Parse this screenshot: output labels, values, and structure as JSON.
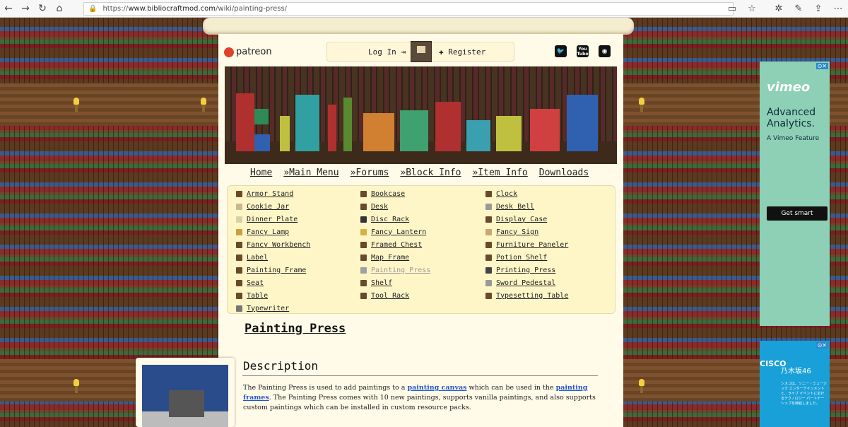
{
  "browser": {
    "url_prefix": "https://",
    "url_host": "www.bibliocraftmod.com",
    "url_path": "/wiki/painting-press/"
  },
  "header": {
    "patreon_label": "patreon",
    "login_label": "Log In",
    "register_label": "Register",
    "social": [
      {
        "name": "twitter-icon",
        "glyph": "t"
      },
      {
        "name": "youtube-icon",
        "glyph": "You Tube"
      },
      {
        "name": "github-icon",
        "glyph": "gh"
      }
    ]
  },
  "menu": {
    "items": [
      "Home",
      "»Main Menu",
      "»Forums",
      "»Block Info",
      "»Item Info",
      "Downloads"
    ]
  },
  "blocks": {
    "col1": [
      "Armor Stand",
      "Cookie Jar",
      "Dinner Plate",
      "Fancy Lamp",
      "Fancy Workbench",
      "Label",
      "Painting Frame",
      "Seat",
      "Table",
      "Typewriter"
    ],
    "col2": [
      "Bookcase",
      "Desk",
      "Disc Rack",
      "Fancy Lantern",
      "Framed Chest",
      "Map Frame",
      "Painting Press",
      "Shelf",
      "Tool Rack"
    ],
    "col3": [
      "Clock",
      "Desk Bell",
      "Display Case",
      "Fancy Sign",
      "Furniture Paneler",
      "Potion Shelf",
      "Printing Press",
      "Sword Pedestal",
      "Typesetting Table"
    ],
    "active": "Painting Press"
  },
  "content": {
    "title": "Painting Press",
    "description_heading": "Description",
    "desc_part1": "The Painting Press is used to add paintings to a ",
    "desc_link1": "painting canvas",
    "desc_part2": " which can be used in the ",
    "desc_link2": "painting frames",
    "desc_part3": ". The Painting Press comes with 10 new paintings, supports vanilla paintings, and also supports custom paintings which can be installed in custom resource packs."
  },
  "ads": {
    "ad1": {
      "brand": "vimeo",
      "headline": "Advanced Analytics.",
      "subline": "A Vimeo Feature",
      "button": "Get smart"
    },
    "ad2": {
      "brand": "CISCO",
      "sub_brand": "乃木坂46",
      "text": "シスコは、ソニー・ミュージック エンターテインメントと、ライブ イベントにおけるテクノロジー パートナーシップを締結しました。"
    }
  },
  "colors": {
    "page_bg": "#fffbe8",
    "menu_panel": "#fff6c8",
    "link": "#2255cc",
    "ad1_bg": "#8ed0b6",
    "ad2_bg": "#1aa0d8"
  }
}
